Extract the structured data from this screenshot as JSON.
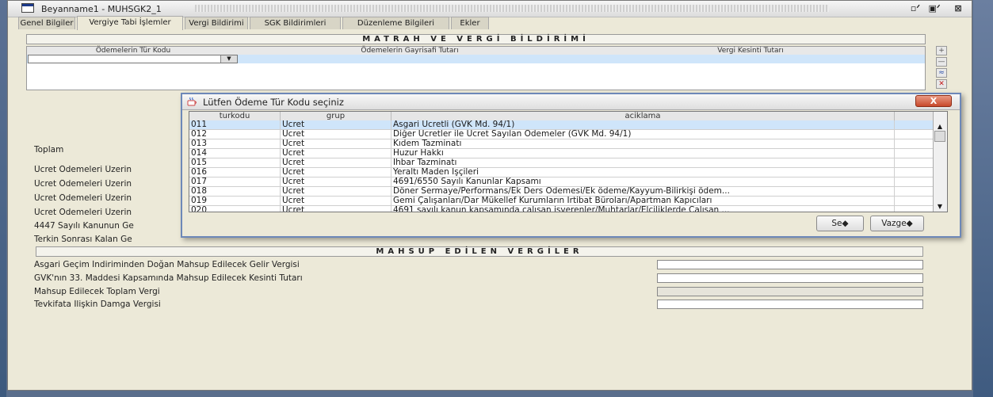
{
  "window": {
    "title": "Beyanname1 - MUHSGK2_1",
    "buttons": {
      "restore": "▫ᐟ",
      "maximize": "▣ᐟ",
      "close": "⊠"
    }
  },
  "tabs": [
    {
      "label": "Genel Bilgiler"
    },
    {
      "label": "Vergiye Tabi İşlemler"
    },
    {
      "label": "Vergi Bildirimi"
    },
    {
      "label": "SGK Bildirimleri"
    },
    {
      "label": "Düzenleme Bilgileri"
    },
    {
      "label": "Ekler"
    }
  ],
  "matrah": {
    "title": "MATRAH VE VERGİ BİLDİRİMİ",
    "columns": [
      "Ödemelerin Tür Kodu",
      "Ödemelerin Gayrisafi Tutarı",
      "Vergi Kesinti Tutarı"
    ]
  },
  "side_buttons": [
    "+",
    "—",
    "≈",
    "✕"
  ],
  "left_labels": [
    "Toplam",
    "Ücret Ödemeleri Üzerin",
    "Ücret Ödemeleri Üzerin",
    "Ücret Ödemeleri Üzerin",
    "Ücret Ödemeleri Üzerin",
    "4447 Sayılı Kanunun Ge",
    "Terkin Sonrası Kalan Ge"
  ],
  "mahsup": {
    "title": "MAHSUP EDİLEN VERGİLER",
    "rows": [
      "Asgari Geçim İndiriminden Doğan Mahsup Edilecek Gelir Vergisi",
      "GVK'nın 33. Maddesi Kapsamında Mahsup Edilecek Kesinti Tutarı",
      "Mahsup Edilecek Toplam Vergi",
      "Tevkifata İlişkin Damga Vergisi"
    ]
  },
  "dialog": {
    "title": "Lütfen Ödeme Tür Kodu seçiniz",
    "close_label": "X",
    "columns": [
      "turkodu",
      "grup",
      "aciklama"
    ],
    "rows": [
      {
        "turkodu": "011",
        "grup": "Ücret",
        "aciklama": "Asgari Ücretli (GVK Md. 94/1)"
      },
      {
        "turkodu": "012",
        "grup": "Ücret",
        "aciklama": "Diğer Ücretler ile Ücret Sayılan Ödemeler (GVK Md. 94/1)"
      },
      {
        "turkodu": "013",
        "grup": "Ücret",
        "aciklama": "Kıdem Tazminatı"
      },
      {
        "turkodu": "014",
        "grup": "Ücret",
        "aciklama": "Huzur Hakkı"
      },
      {
        "turkodu": "015",
        "grup": "Ücret",
        "aciklama": "İhbar Tazminatı"
      },
      {
        "turkodu": "016",
        "grup": "Ücret",
        "aciklama": "Yeraltı Maden İşçileri"
      },
      {
        "turkodu": "017",
        "grup": "Ücret",
        "aciklama": "4691/6550 Sayılı Kanunlar Kapsamı"
      },
      {
        "turkodu": "018",
        "grup": "Ücret",
        "aciklama": "Döner Sermaye/Performans/Ek Ders Ödemesi/Ek ödeme/Kayyum-Bilirkişi ödem..."
      },
      {
        "turkodu": "019",
        "grup": "Ücret",
        "aciklama": "Gemi Çalışanları/Dar Mükellef Kurumların İrtibat Büroları/Apartman Kapıcıları"
      },
      {
        "turkodu": "020",
        "grup": "Ücret",
        "aciklama": "4691 sayılı kanun kapsamında çalışan işverenler/Muhtarlar/Elçiliklerde Çalışan ..."
      }
    ],
    "select_label": "Se◆",
    "cancel_label": "Vazge◆"
  }
}
